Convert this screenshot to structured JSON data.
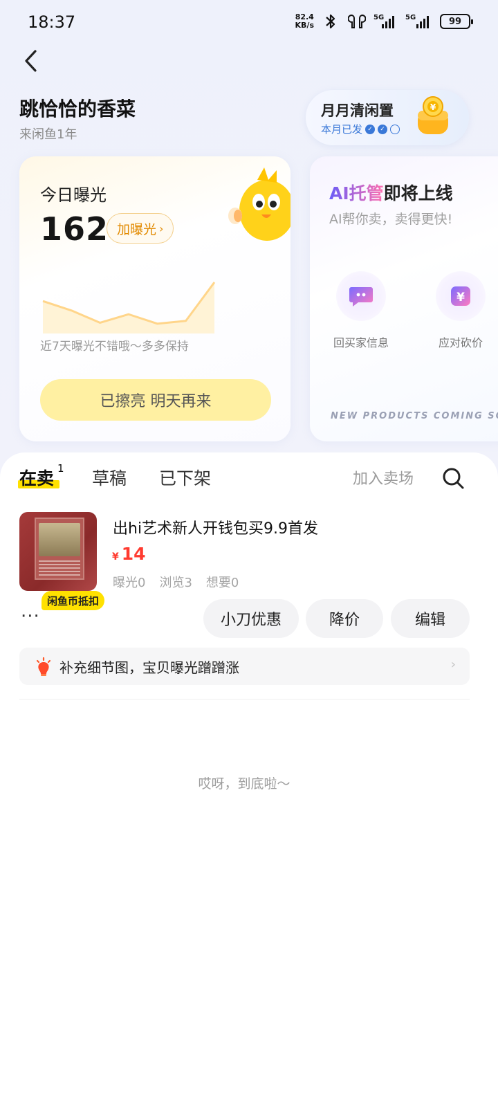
{
  "status": {
    "time": "18:37",
    "net_speed_value": "82.4",
    "net_speed_unit": "KB/s",
    "signal1": "5G",
    "signal2": "5G",
    "battery": "99"
  },
  "profile": {
    "name": "跳恰恰的香菜",
    "tenure": "来闲鱼1年"
  },
  "monthly": {
    "title": "月月清闲置",
    "subtitle": "本月已发",
    "checks_done": 2,
    "checks_total": 3
  },
  "exposure": {
    "title": "今日曝光",
    "value": "162",
    "boost_label": "加曝光",
    "note": "近7天曝光不错哦～多多保持",
    "done_label": "已擦亮 明天再来",
    "trend": [
      3,
      2,
      0.7,
      1.6,
      0.6,
      0.9,
      5
    ]
  },
  "ai": {
    "title_highlight": "AI托管",
    "title_rest": "即将上线",
    "subtitle": "AI帮你卖，卖得更快!",
    "features": [
      "回买家信息",
      "应对砍价"
    ],
    "footer": "NEW PRODUCTS COMING SOO"
  },
  "tabs": {
    "selling": "在卖",
    "selling_count": "1",
    "drafts": "草稿",
    "removed": "已下架"
  },
  "actions": {
    "join_market": "加入卖场"
  },
  "item": {
    "title": "出hi艺术新人开钱包买9.9首发",
    "currency": "¥",
    "price": "14",
    "stats": [
      "曝光0",
      "浏览3",
      "想要0"
    ],
    "coin_badge": "闲鱼币抵扣",
    "more": "···",
    "buttons": {
      "discount": "小刀优惠",
      "reduce": "降价",
      "edit": "编辑"
    }
  },
  "tip": {
    "text": "补充细节图，宝贝曝光蹭蹭涨",
    "arrow": "›"
  },
  "end_text": "哎呀，到底啦～",
  "colors": {
    "accent_yellow": "#ffe100",
    "price_red": "#ff3b30",
    "boost_orange": "#e28a00",
    "link_blue": "#3a78d8"
  }
}
